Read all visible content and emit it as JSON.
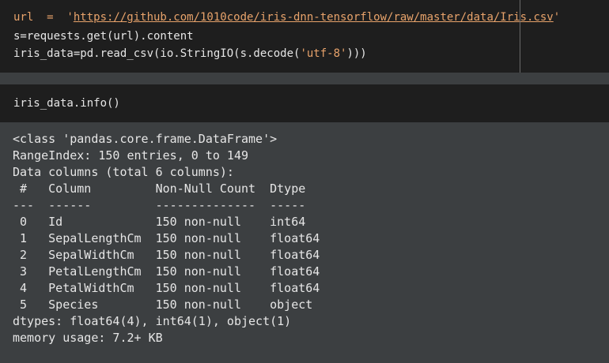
{
  "cell1": {
    "line1_prefix": "url  =  '",
    "line1_url": "https://github.com/1010code/iris-dnn-tensorflow/raw/master/data/Iris.csv",
    "line1_suffix": "'",
    "line2": "s=requests.get(url).content",
    "line3_prefix": "iris_data=pd.read_csv(io.StringIO(s.decode(",
    "line3_str": "'utf-8'",
    "line3_suffix": ")))"
  },
  "cell2": {
    "line1": "iris_data.info()"
  },
  "output": {
    "lines": [
      "<class 'pandas.core.frame.DataFrame'>",
      "RangeIndex: 150 entries, 0 to 149",
      "Data columns (total 6 columns):",
      " #   Column         Non-Null Count  Dtype  ",
      "---  ------         --------------  -----  ",
      " 0   Id             150 non-null    int64  ",
      " 1   SepalLengthCm  150 non-null    float64",
      " 2   SepalWidthCm   150 non-null    float64",
      " 3   PetalLengthCm  150 non-null    float64",
      " 4   PetalWidthCm   150 non-null    float64",
      " 5   Species        150 non-null    object ",
      "dtypes: float64(4), int64(1), object(1)",
      "memory usage: 7.2+ KB"
    ]
  },
  "colors": {
    "cell_background": "#1e1e1e",
    "page_background": "#3c3f41",
    "text": "#e6e6e6",
    "string": "#e8a36b"
  }
}
